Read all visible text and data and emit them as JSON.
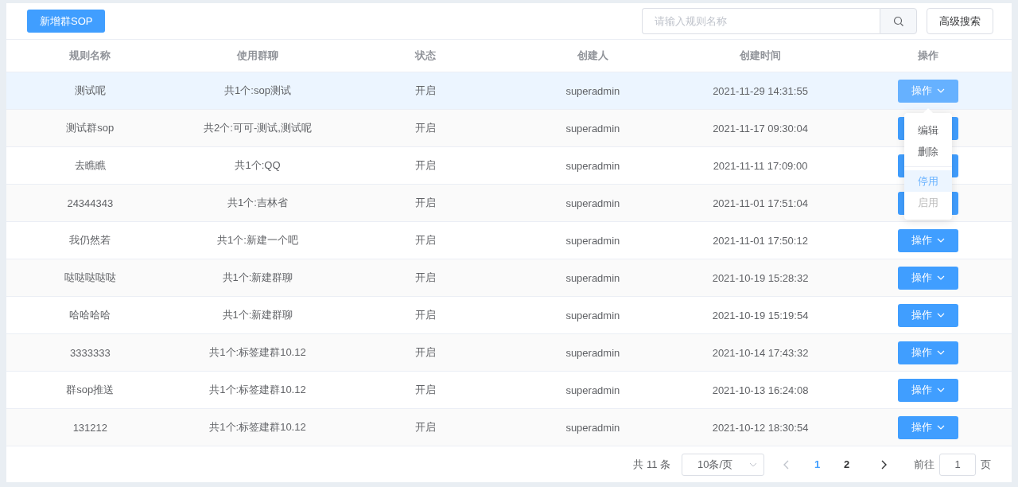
{
  "toolbar": {
    "add_button": "新增群SOP",
    "search": {
      "placeholder": "请输入规则名称"
    },
    "advanced_button": "高级搜索"
  },
  "table": {
    "columns": [
      "规则名称",
      "使用群聊",
      "状态",
      "创建人",
      "创建时间",
      "操作"
    ],
    "rows": [
      {
        "name": "测试呢",
        "groups": "共1个:sop测试",
        "status": "开启",
        "creator": "superadmin",
        "created": "2021-11-29 14:31:55",
        "action": "操作",
        "selected": true
      },
      {
        "name": "测试群sop",
        "groups": "共2个:可可-测试,测试呢",
        "status": "开启",
        "creator": "superadmin",
        "created": "2021-11-17 09:30:04",
        "selected": false
      },
      {
        "name": "去瞧瞧",
        "groups": "共1个:QQ",
        "status": "开启",
        "creator": "superadmin",
        "created": "2021-11-11 17:09:00",
        "selected": false
      },
      {
        "name": "24344343",
        "groups": "共1个:吉林省",
        "status": "开启",
        "creator": "superadmin",
        "created": "2021-11-01 17:51:04",
        "selected": false
      },
      {
        "name": "我仍然若",
        "groups": "共1个:新建一个吧",
        "status": "开启",
        "creator": "superadmin",
        "created": "2021-11-01 17:50:12",
        "action": "操作",
        "selected": false
      },
      {
        "name": "哒哒哒哒哒",
        "groups": "共1个:新建群聊",
        "status": "开启",
        "creator": "superadmin",
        "created": "2021-10-19 15:28:32",
        "action": "操作",
        "selected": false
      },
      {
        "name": "哈哈哈哈",
        "groups": "共1个:新建群聊",
        "status": "开启",
        "creator": "superadmin",
        "created": "2021-10-19 15:19:54",
        "action": "操作",
        "selected": false
      },
      {
        "name": "3333333",
        "groups": "共1个:标签建群10.12",
        "status": "开启",
        "creator": "superadmin",
        "created": "2021-10-14 17:43:32",
        "action": "操作",
        "selected": false
      },
      {
        "name": "群sop推送",
        "groups": "共1个:标签建群10.12",
        "status": "开启",
        "creator": "superadmin",
        "created": "2021-10-13 16:24:08",
        "action": "操作",
        "selected": false
      },
      {
        "name": "131212",
        "groups": "共1个:标签建群10.12",
        "status": "开启",
        "creator": "superadmin",
        "created": "2021-10-12 18:30:54",
        "action": "操作",
        "selected": false
      }
    ]
  },
  "action_menu": {
    "items": [
      {
        "label": "编辑",
        "highlighted": false,
        "disabled": false,
        "divided": false
      },
      {
        "label": "删除",
        "highlighted": false,
        "disabled": false,
        "divided": false
      },
      {
        "label": "停用",
        "highlighted": true,
        "disabled": false,
        "divided": true
      },
      {
        "label": "启用",
        "highlighted": false,
        "disabled": true,
        "divided": false
      }
    ]
  },
  "pagination": {
    "total": "共 11 条",
    "page_size": "10条/页",
    "pages": [
      {
        "label": "1",
        "selected": true
      },
      {
        "label": "2",
        "selected": false
      }
    ],
    "goto_label": "前往",
    "goto_value": "1",
    "goto_suffix": "页"
  }
}
